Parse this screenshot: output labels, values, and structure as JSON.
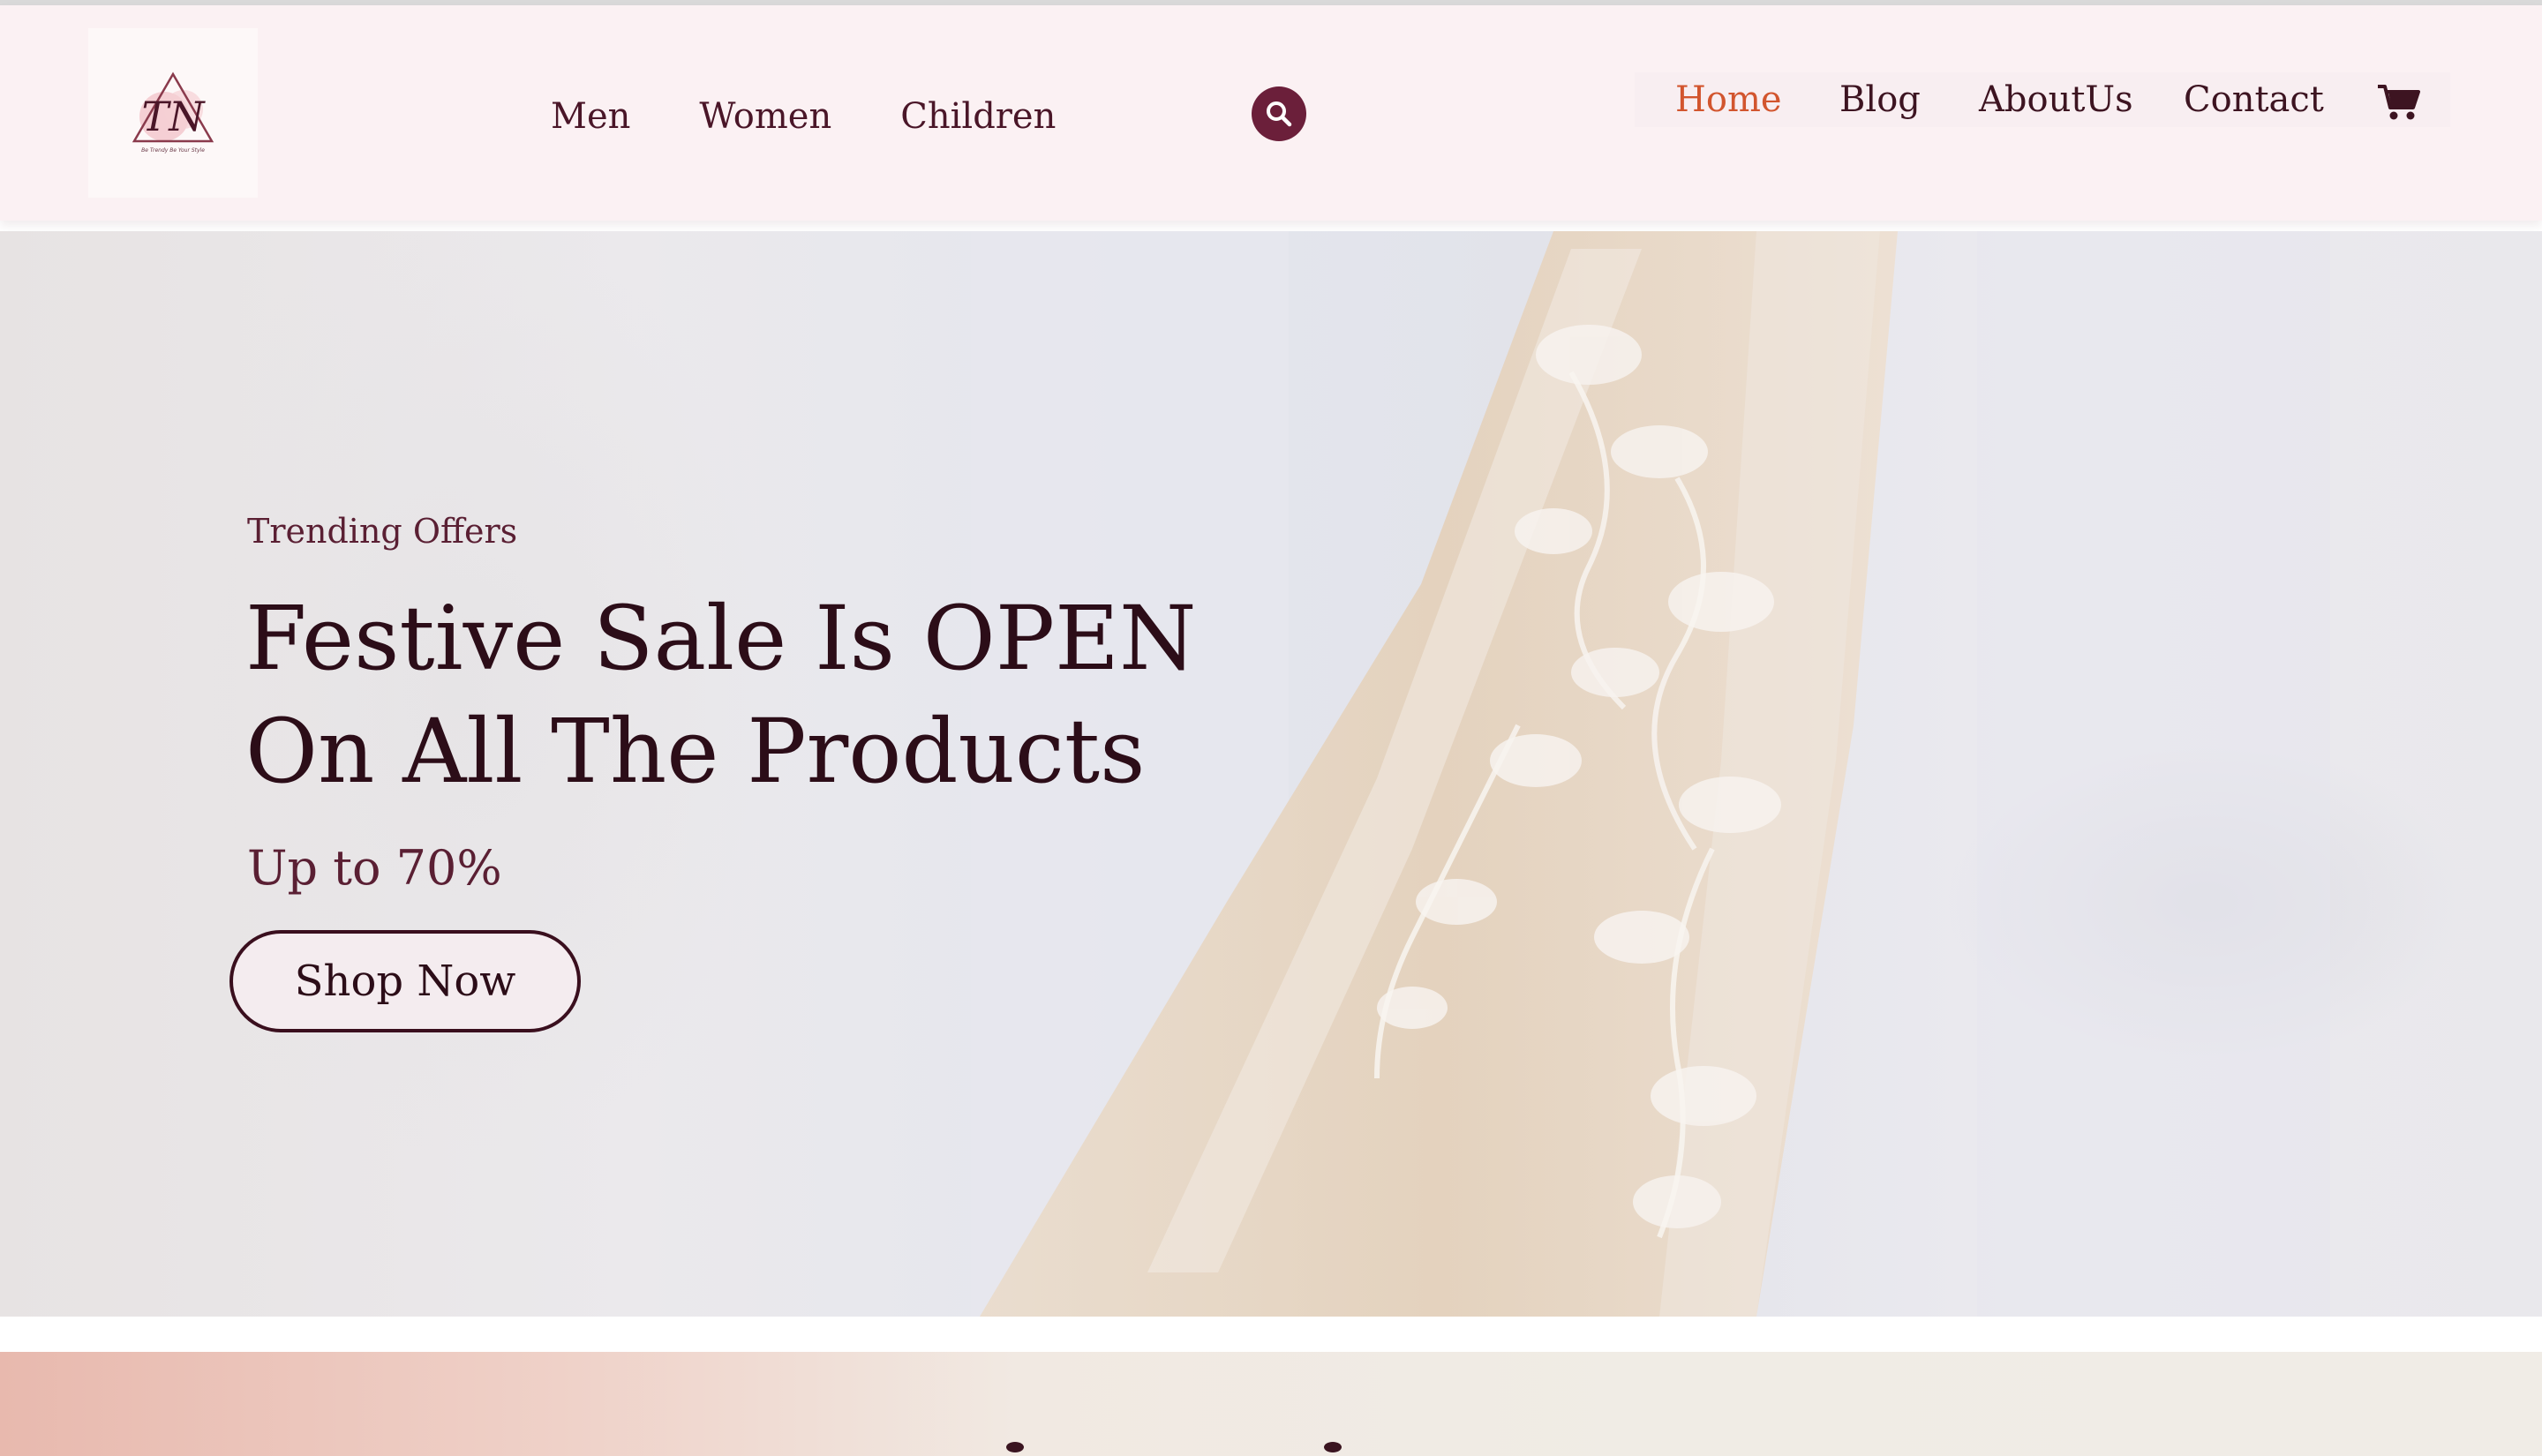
{
  "brand": {
    "logo_text": "TN",
    "logo_tagline": "Be Trendy Be Your Style",
    "colors": {
      "primary": "#6b1f3a",
      "accent": "#d2552e",
      "header_bg": "#fbf1f3"
    }
  },
  "header": {
    "category_nav": [
      "Men",
      "Women",
      "Children"
    ],
    "search_icon": "search-icon",
    "main_nav": [
      {
        "label": "Home",
        "active": true
      },
      {
        "label": "Blog",
        "active": false
      },
      {
        "label": "AboutUs",
        "active": false
      },
      {
        "label": "Contact",
        "active": false
      }
    ],
    "cart_icon": "shopping-cart-icon"
  },
  "hero": {
    "eyebrow": "Trending Offers",
    "title_line1": "Festive Sale Is OPEN",
    "title_line2": "On All The Products",
    "subtitle": "Up to 70%",
    "cta_label": "Shop Now"
  }
}
